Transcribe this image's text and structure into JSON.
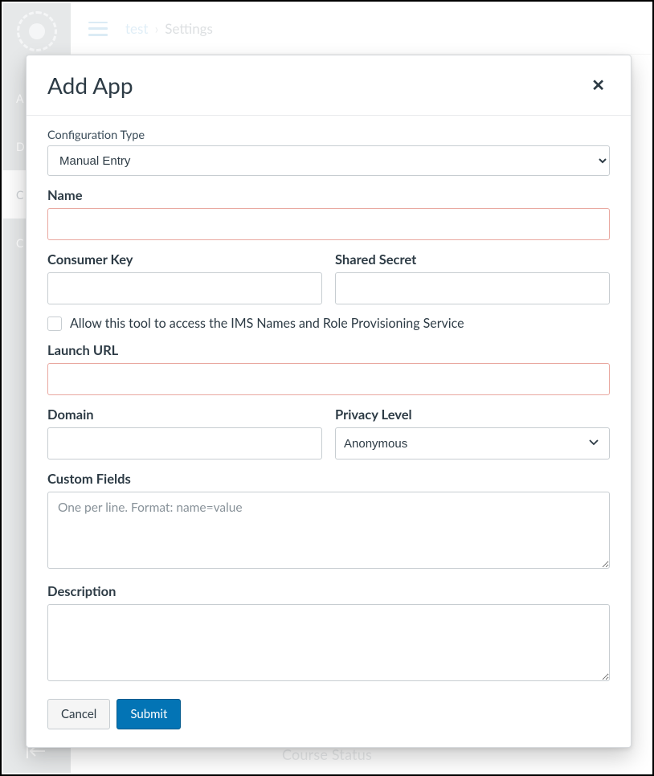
{
  "shell": {
    "breadcrumb_link": "test",
    "breadcrumb_current": "Settings",
    "sidebar_items": [
      "A",
      "D",
      "C",
      "C"
    ],
    "footer_text": "Course Status"
  },
  "modal": {
    "title": "Add App",
    "config_type_label": "Configuration Type",
    "config_type_value": "Manual Entry",
    "name_label": "Name",
    "name_value": "",
    "consumer_key_label": "Consumer Key",
    "consumer_key_value": "",
    "shared_secret_label": "Shared Secret",
    "shared_secret_value": "",
    "ims_checkbox_label": "Allow this tool to access the IMS Names and Role Provisioning Service",
    "ims_checked": false,
    "launch_url_label": "Launch URL",
    "launch_url_value": "",
    "domain_label": "Domain",
    "domain_value": "",
    "privacy_label": "Privacy Level",
    "privacy_value": "Anonymous",
    "custom_fields_label": "Custom Fields",
    "custom_fields_placeholder": "One per line. Format: name=value",
    "custom_fields_value": "",
    "description_label": "Description",
    "description_value": "",
    "cancel_label": "Cancel",
    "submit_label": "Submit"
  }
}
